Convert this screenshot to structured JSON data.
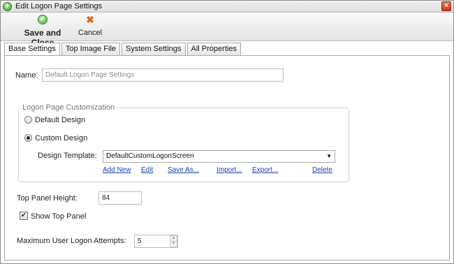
{
  "window": {
    "title": "Edit Logon Page Settings",
    "close_label": "×"
  },
  "toolbar": {
    "save_label": "Save and Close",
    "cancel_label": "Cancel"
  },
  "tabs": [
    {
      "label": "Base Settings",
      "active": true
    },
    {
      "label": "Top Image File",
      "active": false
    },
    {
      "label": "System Settings",
      "active": false
    },
    {
      "label": "All Properties",
      "active": false
    }
  ],
  "form": {
    "name_label": "Name:",
    "name_placeholder": "Default Logon Page Settings",
    "customization_legend": "Logon Page Customization",
    "default_design_label": "Default Design",
    "custom_design_label": "Custom Design",
    "selected_design": "Custom Design",
    "design_template_label": "Design Template:",
    "design_template_value": "DefaultCustomLogonScreen",
    "template_links": {
      "add_new": "Add New",
      "edit": "Edit",
      "save_as": "Save As...",
      "import": "Import...",
      "export": "Export...",
      "delete": "Delete"
    },
    "top_panel_height_label": "Top Panel Height:",
    "top_panel_height_value": "84",
    "show_top_panel_label": "Show Top Panel",
    "show_top_panel_checked": true,
    "max_attempts_label": "Maximum User Logon Attempts:",
    "max_attempts_value": "5"
  },
  "colors": {
    "link": "#1a3fb0",
    "close_button": "#c23b1e",
    "save_icon": "#4aa83a",
    "cancel_icon": "#e06a1a"
  },
  "icons": {
    "title": "plus-circle-icon",
    "save": "check-circle-icon",
    "cancel": "x-icon"
  }
}
